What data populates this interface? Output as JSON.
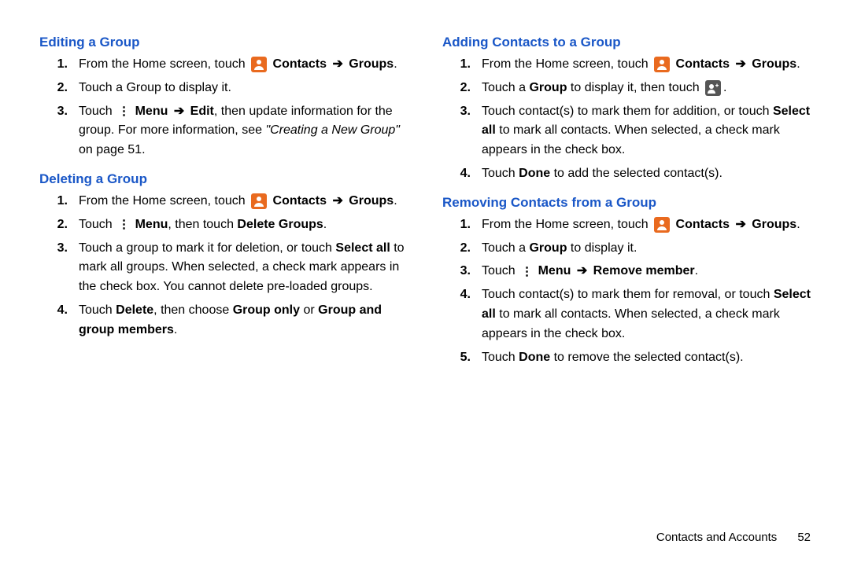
{
  "footer": {
    "section": "Contacts and Accounts",
    "page": "52"
  },
  "arrow": "➔",
  "left": {
    "s1": {
      "heading": "Editing a Group",
      "i1": {
        "a": "From the Home screen, touch ",
        " b": " Contacts ",
        "c": " Groups",
        "d": "."
      },
      "i2": "Touch a Group to display it.",
      "i3": {
        "a": "Touch ",
        "b": " Menu ",
        "c": " Edit",
        "d": ", then update information for the group. For more information, see ",
        "e": "\"Creating a New Group\"",
        "f": " on page 51."
      }
    },
    "s2": {
      "heading": "Deleting a Group",
      "i1": {
        "a": "From the Home screen, touch ",
        " b": " Contacts ",
        "c": " Groups",
        "d": "."
      },
      "i2": {
        "a": "Touch ",
        "b": " Menu",
        "c": ", then touch ",
        "d": "Delete Groups",
        "e": "."
      },
      "i3": {
        "a": "Touch a group to mark it for deletion, or touch ",
        "b": "Select all",
        "c": " to mark all groups. When selected, a check mark appears in the check box. You cannot delete pre-loaded groups."
      },
      "i4": {
        "a": "Touch ",
        "b": "Delete",
        "c": ", then choose ",
        "d": "Group only",
        "e": " or ",
        "f": "Group and group members",
        "g": "."
      }
    }
  },
  "right": {
    "s1": {
      "heading": "Adding Contacts to a Group",
      "i1": {
        "a": "From the Home screen, touch ",
        " b": " Contacts ",
        "c": " Groups",
        "d": "."
      },
      "i2": {
        "a": "Touch a ",
        "b": "Group",
        "c": " to display it, then touch ",
        "d": "."
      },
      "i3": {
        "a": "Touch contact(s) to mark them for addition, or touch ",
        "b": "Select all",
        "c": " to mark all contacts. When selected, a check mark appears in the check box."
      },
      "i4": {
        "a": "Touch ",
        "b": "Done",
        "c": " to add the selected contact(s)."
      }
    },
    "s2": {
      "heading": "Removing Contacts from a Group",
      "i1": {
        "a": "From the Home screen, touch ",
        " b": " Contacts ",
        "c": " Groups",
        "d": "."
      },
      "i2": {
        "a": "Touch a ",
        "b": "Group",
        "c": " to display it."
      },
      "i3": {
        "a": "Touch ",
        "b": " Menu ",
        "c": " Remove member",
        "d": "."
      },
      "i4": {
        "a": "Touch contact(s) to mark them for removal, or touch ",
        "b": "Select all",
        "c": " to mark all contacts. When selected, a check mark appears in the check box."
      },
      "i5": {
        "a": "Touch ",
        "b": "Done",
        "c": " to remove the selected contact(s)."
      }
    }
  }
}
